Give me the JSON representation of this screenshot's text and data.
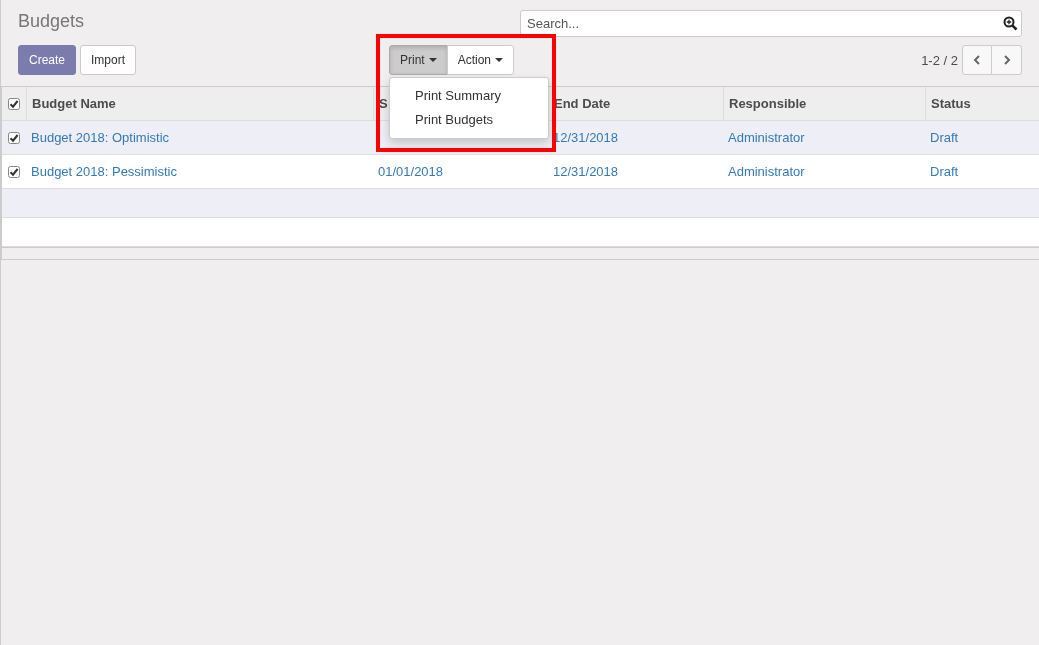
{
  "title": "Budgets",
  "buttons": [
    {
      "label": "Create",
      "kind": "primary"
    },
    {
      "label": "Import",
      "kind": "secondary"
    }
  ],
  "search": {
    "placeholder": "Search..."
  },
  "menus": [
    {
      "label": "Print",
      "open": true,
      "items": [
        "Print Summary",
        "Print Budgets"
      ]
    },
    {
      "label": "Action",
      "open": false
    }
  ],
  "pager": {
    "range": "1-2 / 2"
  },
  "table": {
    "select_all": {
      "checked": true
    },
    "columns": [
      "Budget Name",
      "S",
      "End Date",
      "Responsible",
      "Status"
    ],
    "rows": [
      {
        "selected": true,
        "budget_name": "Budget 2018: Optimistic",
        "end_date": "12/31/2018",
        "responsible": "Administrator",
        "status": "Draft"
      },
      {
        "selected": true,
        "budget_name": "Budget 2018: Pessimistic",
        "start_date": "01/01/2018",
        "end_date": "12/31/2018",
        "responsible": "Administrator",
        "status": "Draft"
      }
    ]
  },
  "highlight": true
}
